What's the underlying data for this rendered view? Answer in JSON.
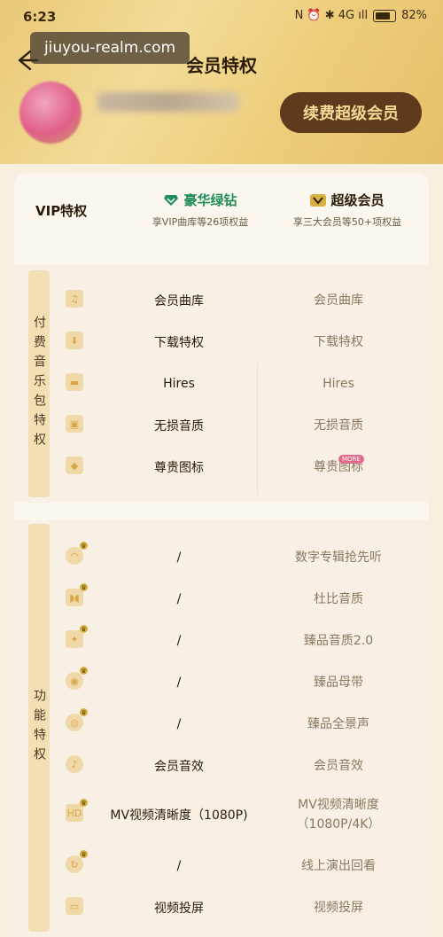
{
  "status_bar": {
    "time": "6:23",
    "battery": "82%",
    "icons_text": "N ⏰ ✱ 4G ıll"
  },
  "header": {
    "title": "会员特权",
    "watermark": "jiuyou-realm.com",
    "renew_button": "续费超级会员"
  },
  "table": {
    "first_col": "VIP特权",
    "col_green": {
      "name": "豪华绿钻",
      "sub": "享VIP曲库等26项权益",
      "color": "#1f8d5a"
    },
    "col_gold": {
      "name": "超级会员",
      "sub": "享三大会员等50+项权益",
      "color": "#d6b042"
    }
  },
  "sections": [
    {
      "label": "付费音乐包特权",
      "rows": [
        {
          "icon": "music-note-icon",
          "green": "会员曲库",
          "gold": "会员曲库"
        },
        {
          "icon": "download-icon",
          "green": "下载特权",
          "gold": "下载特权"
        },
        {
          "icon": "hires-icon",
          "green": "Hires",
          "gold": "Hires"
        },
        {
          "icon": "lossless-icon",
          "green": "无损音质",
          "gold": "无损音质"
        },
        {
          "icon": "diamond-icon",
          "green": "尊贵图标",
          "gold": "尊贵图标",
          "badge": "MORE"
        }
      ]
    },
    {
      "label": "功能特权",
      "rows": [
        {
          "icon": "headphones-icon",
          "green": "/",
          "gold": "数字专辑抢先听"
        },
        {
          "icon": "dolby-icon",
          "green": "/",
          "gold": "杜比音质"
        },
        {
          "icon": "quality-icon",
          "green": "/",
          "gold": "臻品音质2.0"
        },
        {
          "icon": "disc-icon",
          "green": "/",
          "gold": "臻品母带"
        },
        {
          "icon": "surround-icon",
          "green": "/",
          "gold": "臻品全景声"
        },
        {
          "icon": "sound-effect-icon",
          "green": "会员音效",
          "gold": "会员音效"
        },
        {
          "icon": "mv-hd-icon",
          "green": "MV视频清晰度（1080P)",
          "gold": "MV视频清晰度（1080P/4K）"
        },
        {
          "icon": "replay-icon",
          "green": "/",
          "gold": "线上演出回看"
        },
        {
          "icon": "cast-icon",
          "green": "视频投屏",
          "gold": "视频投屏"
        }
      ]
    }
  ]
}
